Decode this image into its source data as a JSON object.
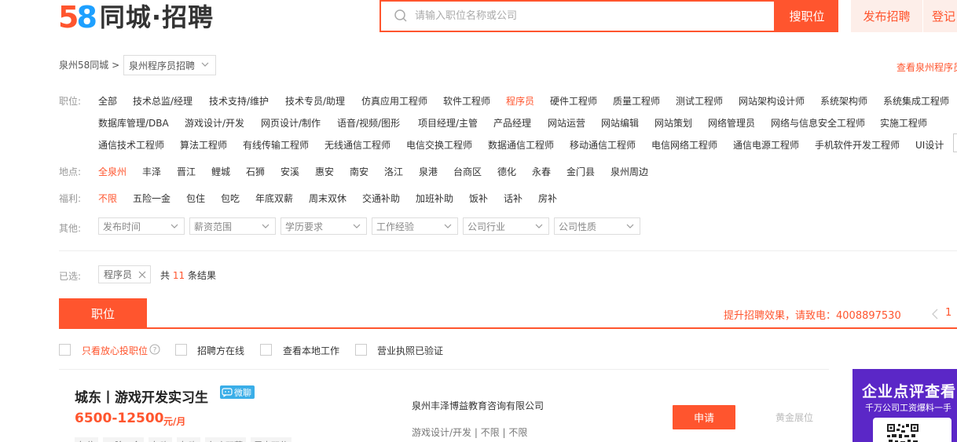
{
  "header": {
    "logo_number_5": "5",
    "logo_number_8": "8",
    "logo_text": "同城·招聘",
    "search_placeholder": "请输入职位名称或公司",
    "search_button": "搜职位",
    "post_button": "发布招聘",
    "login_button": "登记"
  },
  "breadcrumb": {
    "city": "泉州58同城 >",
    "current": "泉州程序员招聘",
    "right_link": "查看泉州程序员"
  },
  "filters": {
    "position_label": "职位:",
    "position_rows": [
      [
        "全部",
        "技术总监/经理",
        "技术支持/维护",
        "技术专员/助理",
        "仿真应用工程师",
        "软件工程师",
        "程序员",
        "硬件工程师",
        "质量工程师",
        "测试工程师",
        "网站架构设计师",
        "系统架构师",
        "系统集成工程师"
      ],
      [
        "数据库管理/DBA",
        "游戏设计/开发",
        "网页设计/制作",
        "语音/视频/图形",
        "项目经理/主管",
        "产品经理",
        "网站运营",
        "网站编辑",
        "网站策划",
        "网络管理员",
        "网络与信息安全工程师",
        "实施工程师"
      ],
      [
        "通信技术工程师",
        "算法工程师",
        "有线传输工程师",
        "无线通信工程师",
        "电信交换工程师",
        "数据通信工程师",
        "移动通信工程师",
        "电信网络工程师",
        "通信电源工程师",
        "手机软件开发工程师",
        "UI设计"
      ]
    ],
    "active_position": "程序员",
    "location_label": "地点:",
    "locations": [
      "全泉州",
      "丰泽",
      "晋江",
      "鲤城",
      "石狮",
      "安溪",
      "惠安",
      "南安",
      "洛江",
      "泉港",
      "台商区",
      "德化",
      "永春",
      "金门县",
      "泉州周边"
    ],
    "active_location": "全泉州",
    "welfare_label": "福利:",
    "welfare": [
      "不限",
      "五险一金",
      "包住",
      "包吃",
      "年底双薪",
      "周末双休",
      "交通补助",
      "加班补助",
      "饭补",
      "话补",
      "房补"
    ],
    "active_welfare": "不限",
    "other_label": "其他:",
    "dropdowns": [
      "发布时间",
      "薪资范围",
      "学历要求",
      "工作经验",
      "公司行业",
      "公司性质"
    ]
  },
  "selected": {
    "label": "已选:",
    "tag": "程序员",
    "result_prefix": "共",
    "result_count": "11",
    "result_suffix": "条结果"
  },
  "tabs": {
    "active": "职位",
    "promo": "提升招聘效果，请致电：4008897530",
    "page": "1"
  },
  "checks": [
    "只看放心投职位",
    "招聘方在线",
    "查看本地工作",
    "营业执照已验证"
  ],
  "job": {
    "title": "城东丨游戏开发实习生",
    "badge": "微聊",
    "salary": "6500-12500",
    "salary_unit": "元/月",
    "tags": [
      "包住",
      "五险一金",
      "包吃",
      "包吃",
      "年底双薪",
      "周末双休"
    ],
    "company": "泉州丰泽博益教育咨询有限公司",
    "meta": "游戏设计/开发  |  不限  |  不限",
    "apply": "申请",
    "gold": "黄金展位"
  },
  "ad": {
    "title": "企业点评查看",
    "subtitle": "千万公司工资爆料一手"
  },
  "colors": {
    "accent": "#ff552e",
    "blue": "#1ea0ff",
    "purple": "#5b27c7"
  }
}
